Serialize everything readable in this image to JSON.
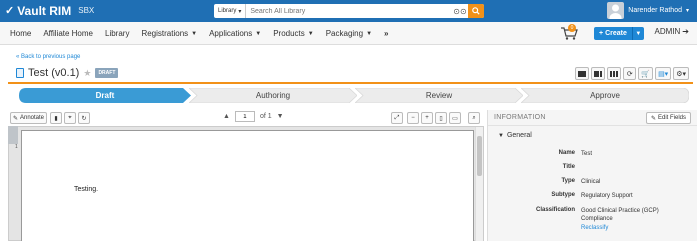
{
  "app": {
    "brand": "Vault RIM",
    "env": "SBX"
  },
  "search": {
    "scope": "Library",
    "placeholder": "Search All Library"
  },
  "user": {
    "name": "Narender Rathod"
  },
  "nav": {
    "items": [
      "Home",
      "Affiliate Home",
      "Library",
      "Registrations",
      "Applications",
      "Products",
      "Packaging"
    ],
    "cart_count": "0",
    "create_label": "Create",
    "admin_label": "ADMIN"
  },
  "doc": {
    "back_link": "« Back to previous page",
    "title": "Test (v0.1)",
    "status_badge": "DRAFT"
  },
  "lifecycle": {
    "stages": [
      "Draft",
      "Authoring",
      "Review",
      "Approve"
    ],
    "active": "Draft"
  },
  "viewer": {
    "annotate_label": "Annotate",
    "page_current": "1",
    "page_total": "of 1",
    "page_number_marker": "1",
    "page_text": "Testing."
  },
  "info": {
    "heading": "INFORMATION",
    "edit_fields_label": "Edit Fields",
    "group": "General",
    "fields": [
      {
        "label": "Name",
        "value": "Test"
      },
      {
        "label": "Title",
        "value": ""
      },
      {
        "label": "Type",
        "value": "Clinical"
      },
      {
        "label": "Subtype",
        "value": "Regulatory Support"
      },
      {
        "label": "Classification",
        "value": "Good Clinical Practice (GCP) Compliance"
      }
    ],
    "reclassify_label": "Reclassify"
  },
  "colors": {
    "brand_blue": "#1f6fb4",
    "accent_orange": "#f29118",
    "active_stage": "#3a9bd5",
    "link_blue": "#1f88d6"
  }
}
